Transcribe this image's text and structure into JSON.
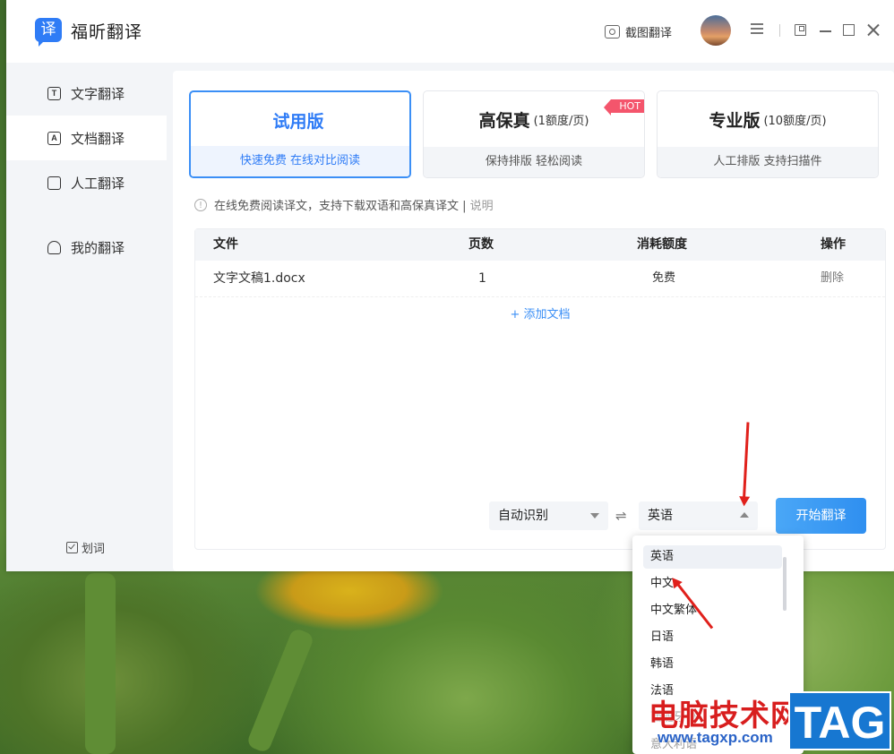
{
  "app": {
    "logo_char": "译",
    "title": "福昕翻译"
  },
  "titlebar": {
    "screenshot_translate_label": "截图翻译"
  },
  "sidebar": {
    "items": [
      {
        "label": "文字翻译",
        "icon": "text-icon",
        "icon_char": "T"
      },
      {
        "label": "文档翻译",
        "icon": "document-icon",
        "icon_char": "A"
      },
      {
        "label": "人工翻译",
        "icon": "human-translate-icon",
        "icon_char": ""
      },
      {
        "label": "我的翻译",
        "icon": "user-icon",
        "icon_char": ""
      }
    ],
    "active_index": 1,
    "word_pick_label": "划词"
  },
  "plans": [
    {
      "name": "试用版",
      "quota": "",
      "desc": "快速免费 在线对比阅读",
      "selected": true
    },
    {
      "name": "高保真",
      "quota": "(1额度/页)",
      "desc": "保持排版 轻松阅读",
      "badge": "HOT"
    },
    {
      "name": "专业版",
      "quota": "(10额度/页)",
      "desc": "人工排版 支持扫描件"
    }
  ],
  "notice": {
    "text": "在线免费阅读译文，支持下载双语和高保真译文 |",
    "link": "说明"
  },
  "table": {
    "headers": [
      "文件",
      "页数",
      "消耗额度",
      "操作"
    ],
    "rows": [
      {
        "file": "文字文稿1.docx",
        "pages": "1",
        "cost": "免费",
        "action": "删除"
      }
    ],
    "add_label": "+ 添加文档"
  },
  "translate": {
    "source_lang": "自动识别",
    "swap_icon": "⇌",
    "target_lang": "英语",
    "start_label": "开始翻译"
  },
  "dropdown": {
    "options": [
      "英语",
      "中文",
      "中文繁体",
      "日语",
      "韩语",
      "法语",
      "西班牙语",
      "意大利语"
    ],
    "selected_index": 0
  },
  "watermark": {
    "text": "电脑技术网",
    "url": "www.tagxp.com",
    "tag": "TAG"
  },
  "colors": {
    "accent": "#2f7cf6",
    "hot": "#f4556c",
    "annotation_arrow": "#e0201b"
  }
}
